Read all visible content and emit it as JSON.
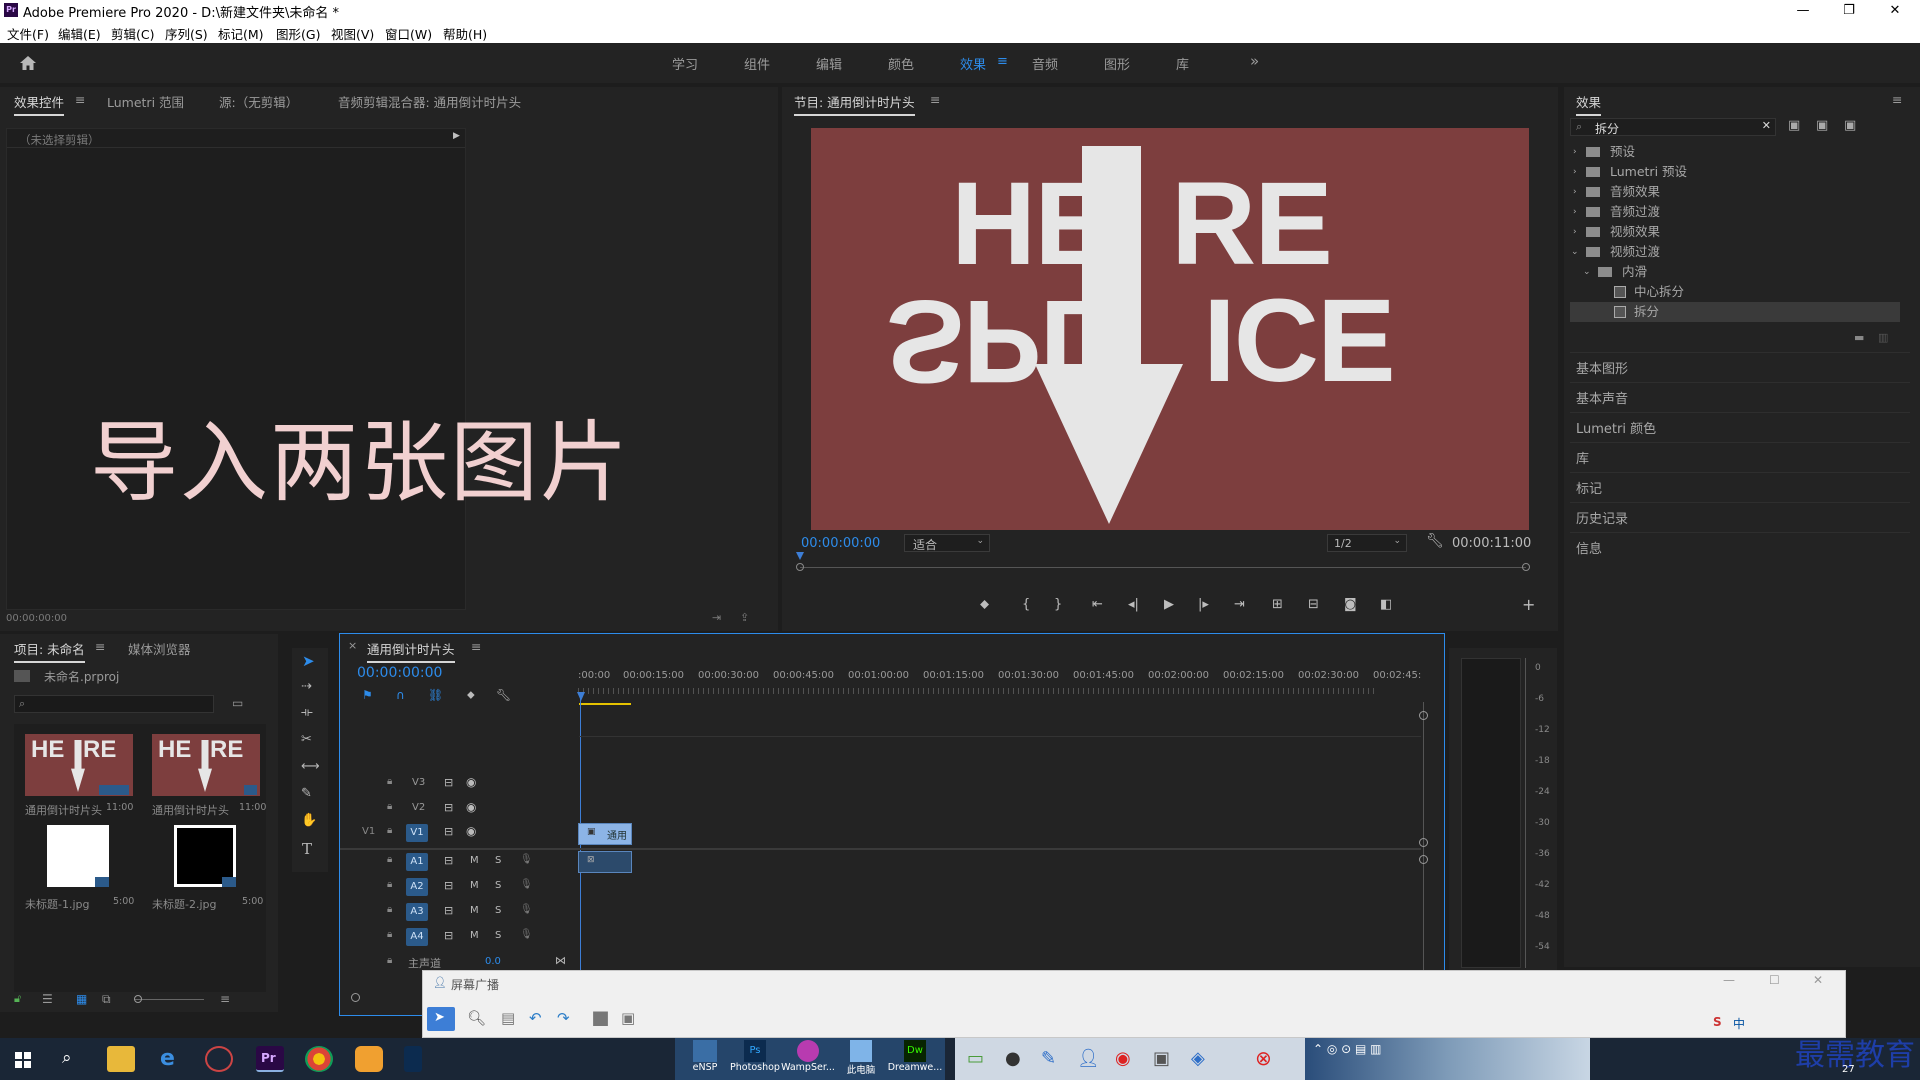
{
  "window": {
    "title": "Adobe Premiere Pro 2020 - D:\\新建文件夹\\未命名 *",
    "logo": "Pr",
    "controls": [
      "minimize",
      "restore",
      "close"
    ]
  },
  "menu": [
    "文件(F)",
    "编辑(E)",
    "剪辑(C)",
    "序列(S)",
    "标记(M)",
    "图形(G)",
    "视图(V)",
    "窗口(W)",
    "帮助(H)"
  ],
  "workspaces": {
    "tabs": [
      "学习",
      "组件",
      "编辑",
      "颜色",
      "效果",
      "音频",
      "图形",
      "库"
    ],
    "active": "效果",
    "more": "»"
  },
  "effect_controls": {
    "tabs": [
      "效果控件",
      "Lumetri 范围",
      "源:（无剪辑）",
      "音频剪辑混合器: 通用倒计时片头"
    ],
    "no_clip": "（未选择剪辑）",
    "timecode": "00:00:00:00",
    "overlay_text": "导入两张图片"
  },
  "program_monitor": {
    "title": "节目: 通用倒计时片头",
    "timecode_current": "00:00:00:00",
    "fit": "适合",
    "resolution": "1/2",
    "timecode_duration": "00:00:11:00",
    "frame_text_top_left": "HE",
    "frame_text_top_right": "RE",
    "frame_text_bottom_left": "SPL",
    "frame_text_bottom_right": "ICE",
    "frame_bg": "#7d3e3e"
  },
  "effects_panel": {
    "title": "效果",
    "search_value": "拆分",
    "tree": [
      {
        "label": "预设",
        "level": 0
      },
      {
        "label": "Lumetri 预设",
        "level": 0
      },
      {
        "label": "音频效果",
        "level": 0
      },
      {
        "label": "音频过渡",
        "level": 0
      },
      {
        "label": "视频效果",
        "level": 0
      },
      {
        "label": "视频过渡",
        "level": 0
      },
      {
        "label": "内滑",
        "level": 1
      },
      {
        "label": "中心拆分",
        "level": 2
      },
      {
        "label": "拆分",
        "level": 2
      }
    ],
    "selected": "拆分"
  },
  "side_panels": [
    "基本图形",
    "基本声音",
    "Lumetri 颜色",
    "库",
    "标记",
    "历史记录",
    "信息"
  ],
  "project": {
    "tabs": [
      "项目: 未命名",
      "媒体浏览器"
    ],
    "file": "未命名.prproj",
    "items": [
      {
        "name": "通用倒计时片头",
        "duration": "11:00",
        "kind": "splice"
      },
      {
        "name": "通用倒计时片头",
        "duration": "11:00",
        "kind": "splice"
      },
      {
        "name": "未标题-1.jpg",
        "duration": "5:00",
        "kind": "white"
      },
      {
        "name": "未标题-2.jpg",
        "duration": "5:00",
        "kind": "black"
      }
    ]
  },
  "timeline": {
    "title": "通用倒计时片头",
    "timecode": "00:00:00:00",
    "ruler": [
      ":00:00",
      "00:00:15:00",
      "00:00:30:00",
      "00:00:45:00",
      "00:01:00:00",
      "00:01:15:00",
      "00:01:30:00",
      "00:01:45:00",
      "00:02:00:00",
      "00:02:15:00",
      "00:02:30:00",
      "00:02:45:"
    ],
    "video_tracks": [
      "V3",
      "V2",
      "V1"
    ],
    "audio_tracks": [
      "A1",
      "A2",
      "A3",
      "A4"
    ],
    "source_patch": "V1",
    "master": "主声道",
    "master_value": "0.0",
    "clip_label": "通用"
  },
  "audio_meter": {
    "scale": [
      "0",
      "-6",
      "-12",
      "-18",
      "-24",
      "-30",
      "-36",
      "-42",
      "-48",
      "-54"
    ]
  },
  "screen_broadcast": {
    "title": "屏幕广播"
  },
  "taskbar": {
    "group_items": [
      "eNSP",
      "Photoshop",
      "WampSer...",
      "此电脑",
      "Dreamwe..."
    ],
    "ime": "中",
    "watermark": "最需教育",
    "clock_partial": "27"
  },
  "colors": {
    "accent": "#2d8ceb",
    "timecode": "#2d8ceb",
    "playhead": "#3d7ed6",
    "clip": "#8cb4e6"
  }
}
